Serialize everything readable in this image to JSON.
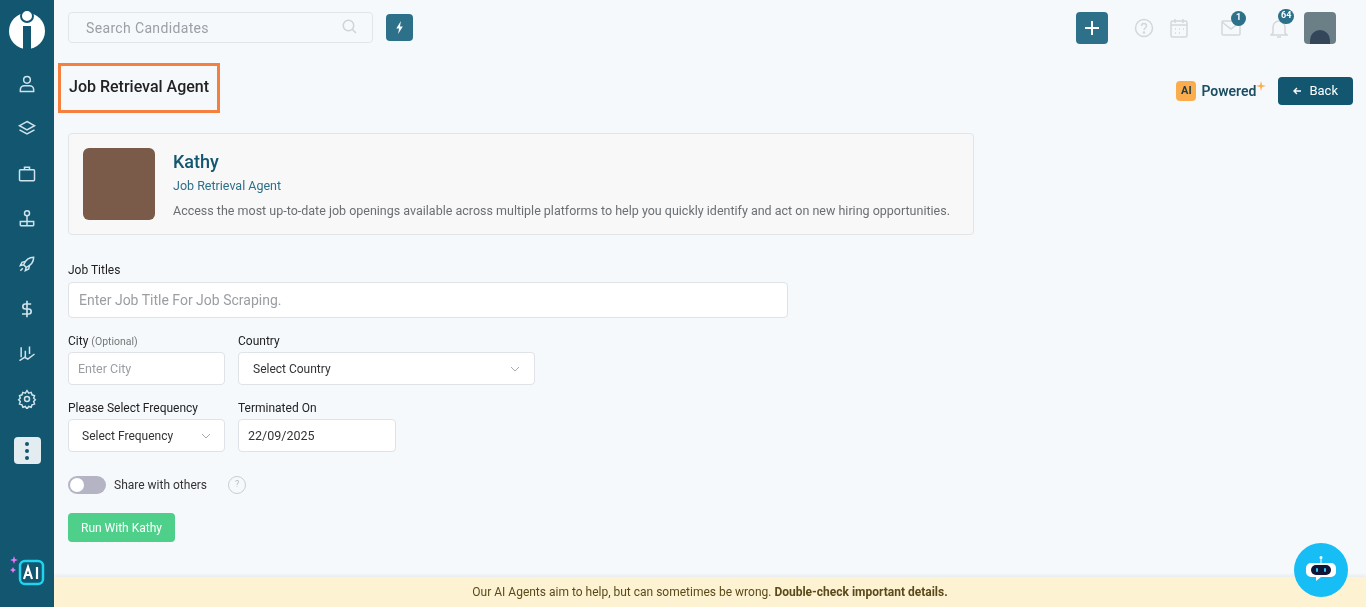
{
  "search": {
    "placeholder": "Search Candidates"
  },
  "notifications": {
    "messages_badge": "1",
    "alerts_badge": "64"
  },
  "page_title": "Job Retrieval Agent",
  "ai_powered": {
    "badge": "AI",
    "label": "Powered"
  },
  "back_button": "Back",
  "agent": {
    "name": "Kathy",
    "role": "Job Retrieval Agent",
    "description": "Access the most up-to-date job openings available across multiple platforms to help you quickly identify and act on new hiring opportunities."
  },
  "form": {
    "job_titles": {
      "label": "Job Titles",
      "placeholder": "Enter Job Title For Job Scraping."
    },
    "city": {
      "label": "City",
      "hint": "(Optional)",
      "placeholder": "Enter City"
    },
    "country": {
      "label": "Country",
      "value": "Select Country"
    },
    "frequency": {
      "label": "Please Select Frequency",
      "value": "Select Frequency"
    },
    "terminated_on": {
      "label": "Terminated On",
      "value": "22/09/2025"
    },
    "share": {
      "label": "Share with others",
      "on": false,
      "help": "?"
    },
    "run_button": "Run With Kathy"
  },
  "notice": "Our AI Agents aim to help, but can sometimes be wrong. **Double-check important details.**"
}
